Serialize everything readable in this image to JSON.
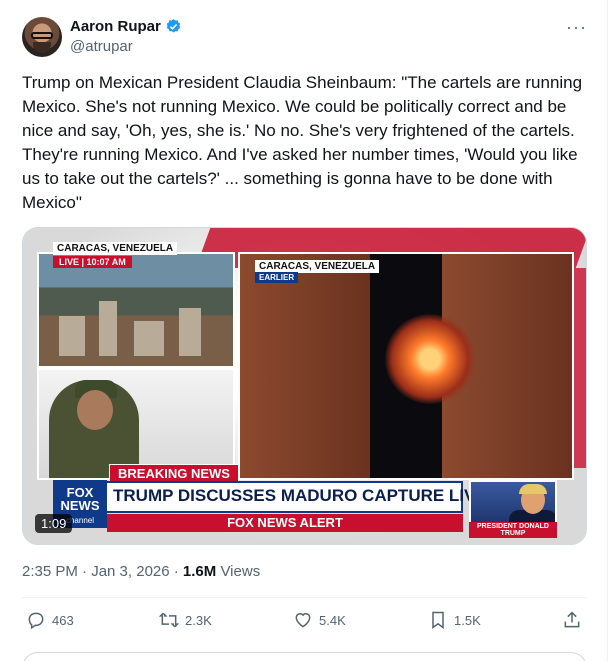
{
  "author": {
    "display_name": "Aaron Rupar",
    "handle": "@atrupar",
    "verified": true,
    "avatar_icon": "avatar-photo"
  },
  "more_label": "···",
  "tweet_text": "Trump on Mexican President Claudia Sheinbaum: \"The cartels are running Mexico. She's not running Mexico. We could be politically correct and be nice and say, 'Oh, yes, she is.' No no. She's very frightened of the cartels. They're running Mexico. And I've asked her number times, 'Would you like us to take out the cartels?' ... something is gonna have to be done with Mexico\"",
  "media": {
    "duration": "1:09",
    "left_location": "CARACAS, VENEZUELA",
    "live_label": "LIVE | 10:07 AM",
    "right_location": "CARACAS, VENEZUELA",
    "earlier_label": "EARLIER",
    "breaking_label": "BREAKING NEWS",
    "logo_text": "FOX NEWS",
    "logo_sub": "channel",
    "headline": "TRUMP DISCUSSES MADURO CAPTURE LIVE ON F&F",
    "alert_label": "FOX NEWS ALERT",
    "caption": "PRESIDENT DONALD TRUMP"
  },
  "meta": {
    "time": "2:35 PM · Jan 3, 2026 · ",
    "views_count": "1.6M",
    "views_label": " Views"
  },
  "actions": {
    "replies": "463",
    "retweets": "2.3K",
    "likes": "5.4K",
    "bookmarks": "1.5K"
  },
  "colors": {
    "text": "#0f1419",
    "muted": "#536471",
    "verified": "#1d9bf0",
    "fox_red": "#c8102e",
    "fox_blue": "#0f3a8a"
  }
}
